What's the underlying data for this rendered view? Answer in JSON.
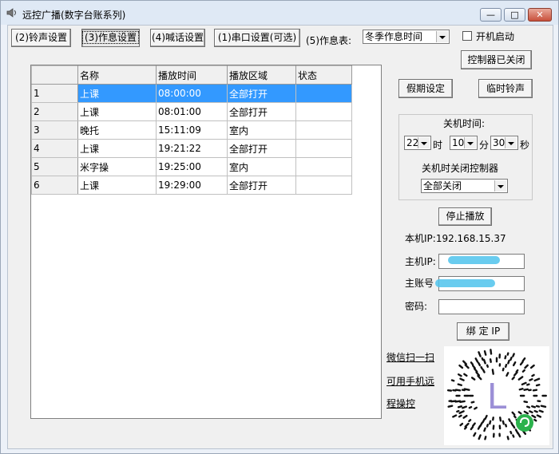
{
  "window": {
    "title": "远控广播(数字台账系列)"
  },
  "tabs": [
    "(2)铃声设置",
    "(3)作息设置",
    "(4)喊话设置",
    "(1)串口设置(可选)"
  ],
  "schedule": {
    "label": "(5)作息表:",
    "value": "冬季作息时间"
  },
  "autostart": {
    "label": "开机启动"
  },
  "controller_btn": "控制器已关闭",
  "table": {
    "headers": [
      "名称",
      "播放时间",
      "播放区域",
      "状态"
    ],
    "rows": [
      {
        "num": "1",
        "name": "上课",
        "time": "08:00:00",
        "area": "全部打开",
        "status": ""
      },
      {
        "num": "2",
        "name": "上课",
        "time": "08:01:00",
        "area": "全部打开",
        "status": ""
      },
      {
        "num": "3",
        "name": "晚托",
        "time": "15:11:09",
        "area": "室内",
        "status": ""
      },
      {
        "num": "4",
        "name": "上课",
        "time": "19:21:22",
        "area": "全部打开",
        "status": ""
      },
      {
        "num": "5",
        "name": "米字操",
        "time": "19:25:00",
        "area": "室内",
        "status": ""
      },
      {
        "num": "6",
        "name": "上课",
        "time": "19:29:00",
        "area": "全部打开",
        "status": ""
      }
    ]
  },
  "holiday_btn": "假期设定",
  "temp_bell_btn": "临时铃声",
  "shutdown": {
    "title": "关机时间:",
    "hour": "22",
    "hour_unit": "时",
    "minute": "10",
    "minute_unit": "分",
    "second": "30",
    "second_unit": "秒",
    "controller_label": "关机时关闭控制器",
    "controller_value": "全部关闭"
  },
  "stop_btn": "停止播放",
  "local_ip": "本机IP:192.168.15.37",
  "host_ip_label": "主机IP:",
  "host_account_label": "主账号",
  "password_label": "密码:",
  "bind_btn": "绑 定 IP",
  "wechat_links": [
    "微信扫一扫",
    "可用手机远",
    "程操控"
  ],
  "qr": {
    "center_letter": "L",
    "icon": "wechat-miniprogram-icon",
    "accent": "#9b8fd6"
  },
  "colors": {
    "selection": "#3399ff",
    "blur": "#4fc3ec"
  }
}
